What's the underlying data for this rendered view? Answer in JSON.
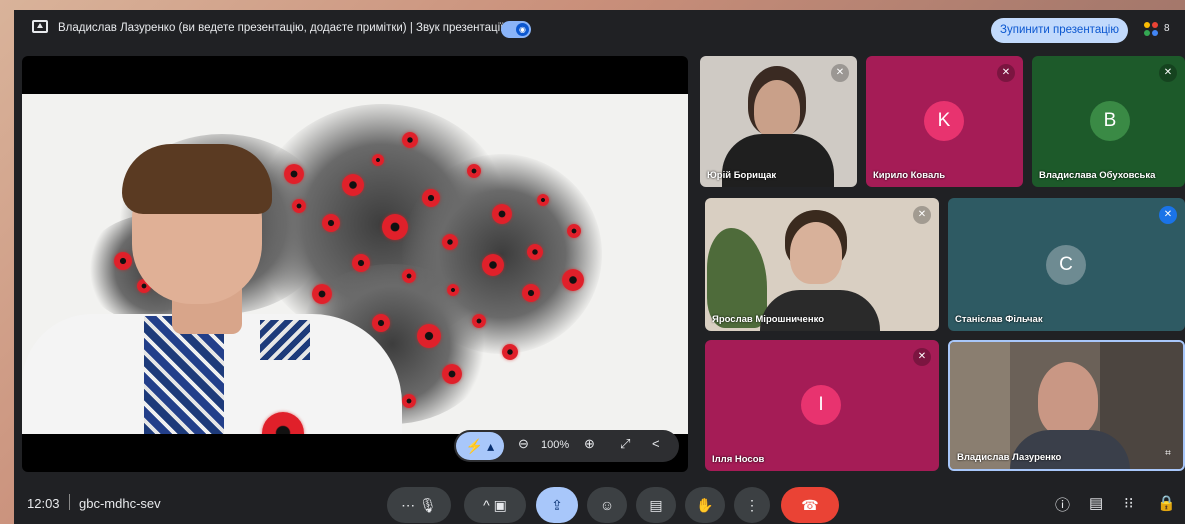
{
  "topbar": {
    "presenter_text": "Владислав Лазуренко (ви ведете презентацію, додаєте примітки)  |  Звук презентації",
    "stop_button": "Зупинити презентацію",
    "people_count": "8"
  },
  "stage": {
    "zoom_level": "100%"
  },
  "participants": [
    {
      "name": "Юрій Борищак",
      "type": "video"
    },
    {
      "name": "Кирило Коваль",
      "initial": "K",
      "type": "avatar",
      "bg": "#a51c56",
      "avatar_color": "#e8336f"
    },
    {
      "name": "Владислава Обуховська",
      "initial": "B",
      "type": "avatar",
      "bg": "#1d5a2a",
      "avatar_color": "#3a8a45"
    },
    {
      "name": "Ярослав Мірошниченко",
      "type": "video"
    },
    {
      "name": "Станіслав Фільчак",
      "initial": "C",
      "type": "avatar",
      "bg": "#2e5a63",
      "avatar_color": "#6e8b92"
    },
    {
      "name": "Ілля Носов",
      "initial": "I",
      "type": "avatar",
      "bg": "#a51c56",
      "avatar_color": "#e8336f"
    },
    {
      "name": "Владислав Лазуренко",
      "type": "video"
    }
  ],
  "bottombar": {
    "time": "12:03",
    "meeting_code": "gbc-mdhc-sev"
  },
  "colors": {
    "accent": "#a8c7fa",
    "end_call": "#ea4335",
    "background": "#202124"
  }
}
